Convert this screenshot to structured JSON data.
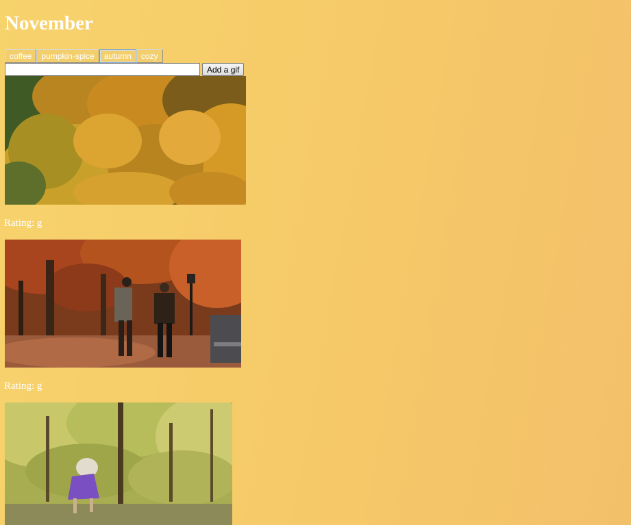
{
  "page": {
    "title": "November"
  },
  "tags": [
    {
      "label": "coffee",
      "active": false
    },
    {
      "label": "pumpkin-spice",
      "active": false
    },
    {
      "label": "autumn",
      "active": true
    },
    {
      "label": "cozy",
      "active": false
    }
  ],
  "add_form": {
    "input_value": "",
    "button_label": "Add a gif"
  },
  "gifs": [
    {
      "description": "autumn-forest-canopy",
      "rating_label": "Rating: g"
    },
    {
      "description": "two-men-walking-in-autumn-park",
      "rating_label": "Rating: g"
    },
    {
      "description": "woman-in-purple-in-yellow-woods",
      "rating_label": ""
    }
  ],
  "colors": {
    "background_start": "#f7d36c",
    "background_end": "#f3c06a",
    "text": "#ffffff"
  }
}
